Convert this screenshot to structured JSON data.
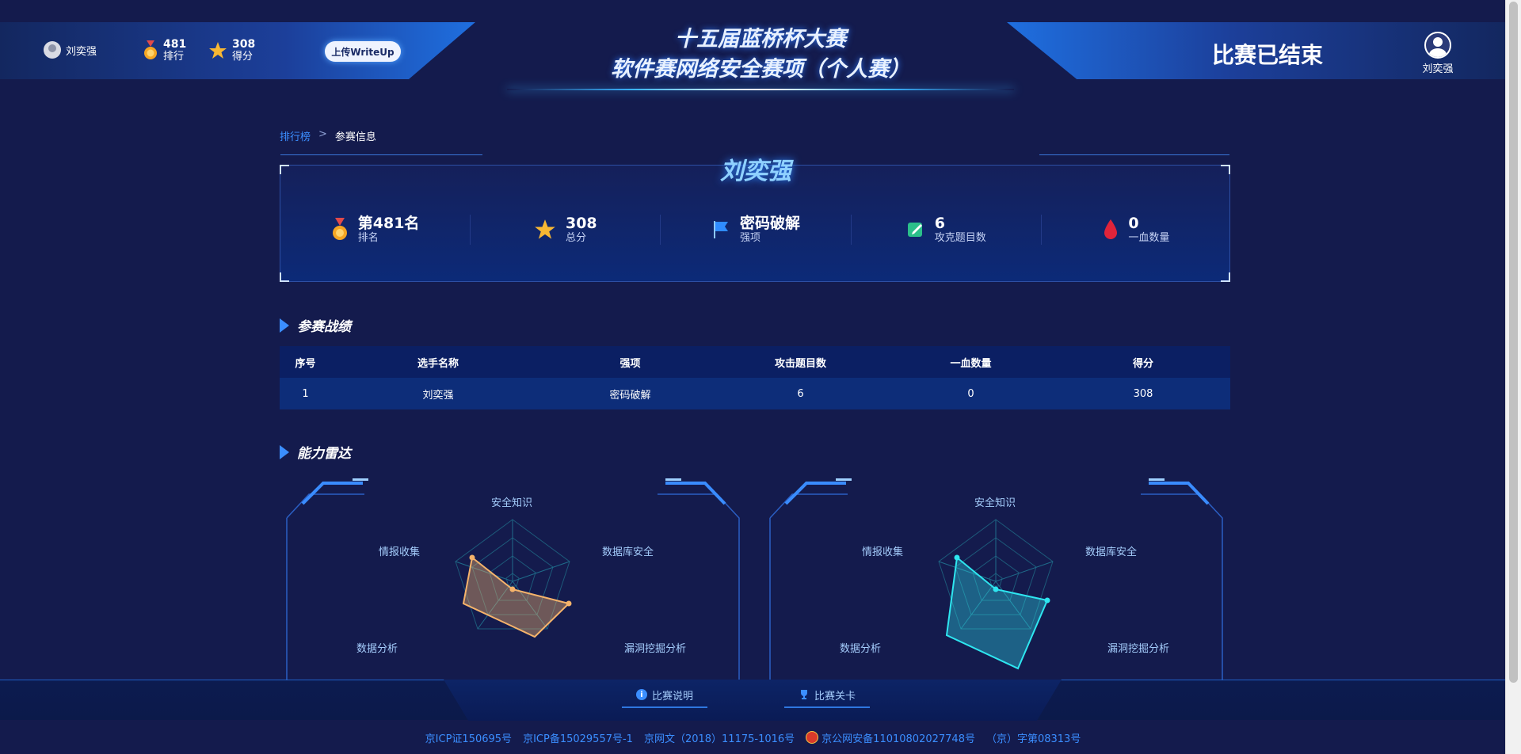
{
  "header": {
    "username": "刘奕强",
    "rank_value": "481",
    "rank_label": "排行",
    "score_value": "308",
    "score_label": "得分",
    "upload_button": "上传WriteUp",
    "title_line1": "十五届蓝桥杯大赛",
    "title_line2": "软件赛网络安全赛项（个人赛）",
    "status": "比赛已结束",
    "right_username": "刘奕强"
  },
  "breadcrumb": {
    "parent": "排行榜",
    "separator": ">",
    "current": "参赛信息"
  },
  "profile": {
    "name": "刘奕强",
    "stats": [
      {
        "value": "第481名",
        "label": "排名",
        "icon": "medal-icon"
      },
      {
        "value": "308",
        "label": "总分",
        "icon": "star-icon"
      },
      {
        "value": "密码破解",
        "label": "强项",
        "icon": "flag-icon"
      },
      {
        "value": "6",
        "label": "攻克题目数",
        "icon": "edit-icon"
      },
      {
        "value": "0",
        "label": "一血数量",
        "icon": "blood-drop-icon"
      }
    ]
  },
  "sections": {
    "record": "参赛战绩",
    "radar": "能力雷达"
  },
  "table": {
    "headers": [
      "序号",
      "选手名称",
      "强项",
      "攻击题目数",
      "一血数量",
      "得分"
    ],
    "rows": [
      [
        "1",
        "刘奕强",
        "密码破解",
        "6",
        "0",
        "308"
      ]
    ]
  },
  "radar": {
    "axes": [
      "安全知识",
      "数据库安全",
      "漏洞挖掘分析",
      "数据分析",
      "情报收集"
    ],
    "left_color": "#f5b36b",
    "right_color": "#2ee6f0"
  },
  "footer": {
    "btn_rules": "比赛说明",
    "btn_levels": "比赛关卡",
    "icp": [
      "京ICP证150695号",
      "京ICP备15029557号-1",
      "京网文（2018）11175-1016号",
      "京公网安备11010802027748号",
      "（京）字第08313号"
    ]
  },
  "colors": {
    "background": "#141b4d",
    "accent": "#3b8eff"
  }
}
